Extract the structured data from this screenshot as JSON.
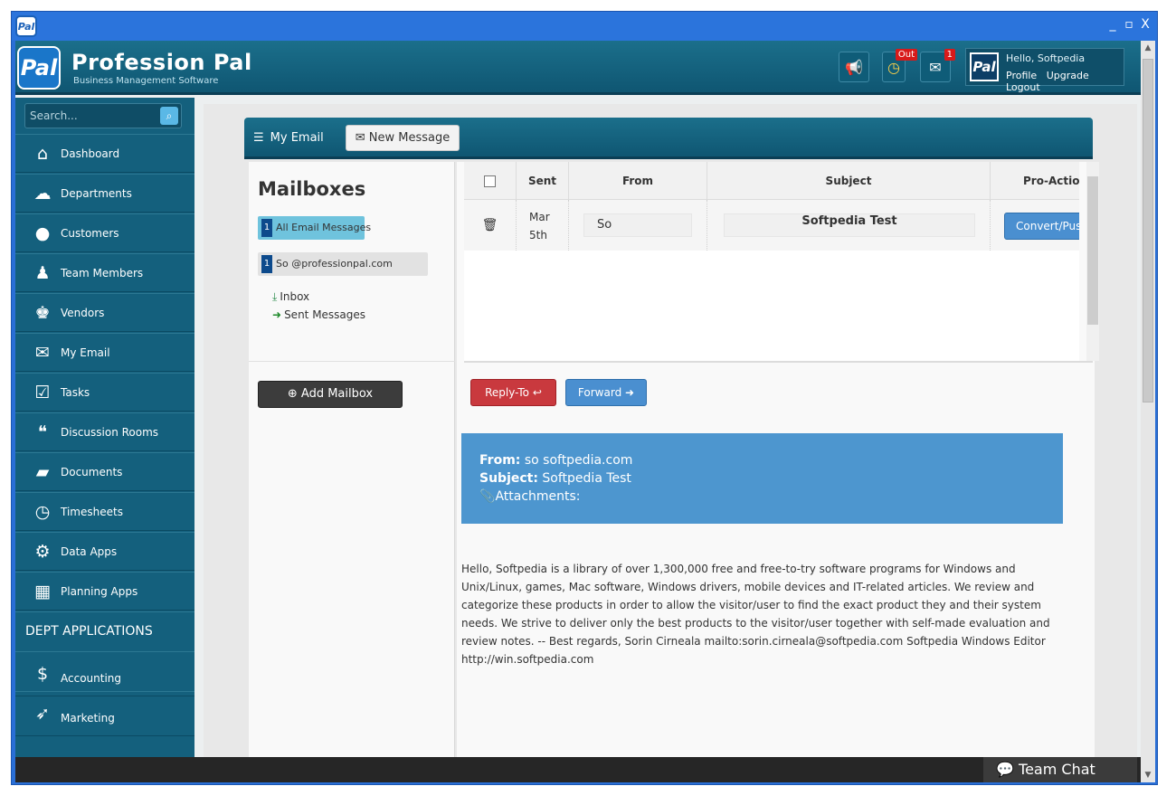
{
  "window": {
    "icon_text": "Pal",
    "minimize": "_",
    "restore": "▫",
    "close": "X"
  },
  "brand": {
    "logo_text": "Pal",
    "name": "Profession Pal",
    "tagline": "Business Management Software"
  },
  "topbar": {
    "clock_badge": "Out",
    "mail_badge": "1",
    "user": {
      "avatar_text": "Pal",
      "greeting": "Hello, Softpedia",
      "links": [
        "Profile",
        "Upgrade",
        "Logout"
      ]
    }
  },
  "sidebar": {
    "search_placeholder": "Search...",
    "items": [
      {
        "label": "Dashboard",
        "icon": "home-icon",
        "glyph": "⌂"
      },
      {
        "label": "Departments",
        "icon": "cloud-icon",
        "glyph": "☁"
      },
      {
        "label": "Customers",
        "icon": "user-icon",
        "glyph": "●"
      },
      {
        "label": "Team Members",
        "icon": "tie-icon",
        "glyph": "♟"
      },
      {
        "label": "Vendors",
        "icon": "users-icon",
        "glyph": "♚"
      },
      {
        "label": "My Email",
        "icon": "envelope-icon",
        "glyph": "✉"
      },
      {
        "label": "Tasks",
        "icon": "checkbox-icon",
        "glyph": "☑"
      },
      {
        "label": "Discussion Rooms",
        "icon": "chat-icon",
        "glyph": "❝"
      },
      {
        "label": "Documents",
        "icon": "folder-icon",
        "glyph": "▰"
      },
      {
        "label": "Timesheets",
        "icon": "clock-icon",
        "glyph": "◷"
      },
      {
        "label": "Data Apps",
        "icon": "gear-icon",
        "glyph": "⚙"
      },
      {
        "label": "Planning Apps",
        "icon": "calendar-icon",
        "glyph": "▦"
      }
    ],
    "section_head": "DEPT APPLICATIONS",
    "dept_items": [
      {
        "label": "Accounting",
        "icon": "dollar-icon",
        "glyph": "$"
      },
      {
        "label": "Marketing",
        "icon": "rocket-icon",
        "glyph": "➶"
      }
    ]
  },
  "panel": {
    "title": "My Email",
    "new_message": "New Message"
  },
  "mailboxes": {
    "title": "Mailboxes",
    "tags": [
      {
        "count": "1",
        "label": "All Email Messages"
      },
      {
        "count": "1",
        "label": "So          @professionpal.com"
      }
    ],
    "folders": [
      "Inbox",
      "Sent Messages"
    ],
    "add_button": "Add Mailbox"
  },
  "table": {
    "columns": [
      "Sent",
      "From",
      "Subject",
      "Pro-Actions"
    ],
    "rows": [
      {
        "sent": "Mar 5th",
        "from": "So          ",
        "subject": "Softpedia Test",
        "action": "Convert/Push"
      }
    ]
  },
  "message": {
    "reply_label": "Reply-To",
    "forward_label": "Forward",
    "from_label": "From:",
    "from_value": "so              softpedia.com",
    "subject_label": "Subject:",
    "subject_value": "Softpedia Test",
    "attachments_label": "Attachments:",
    "body": "Hello, Softpedia is a library of over 1,300,000 free and free-to-try software programs for Windows and Unix/Linux, games, Mac software, Windows drivers, mobile devices and IT-related articles. We review and categorize these products in order to allow the visitor/user to find the exact product they and their system needs. We strive to deliver only the best products to the visitor/user together with self-made evaluation and review notes. -- Best regards, Sorin Cirneala mailto:sorin.cirneala@softpedia.com Softpedia Windows Editor http://win.softpedia.com"
  },
  "team_chat": "Team Chat",
  "colors": {
    "topbar": "#14607d",
    "window_frame": "#2a6fd6",
    "reply": "#c9393e",
    "forward": "#4a8fd0",
    "mail_header": "#4d96cf"
  }
}
